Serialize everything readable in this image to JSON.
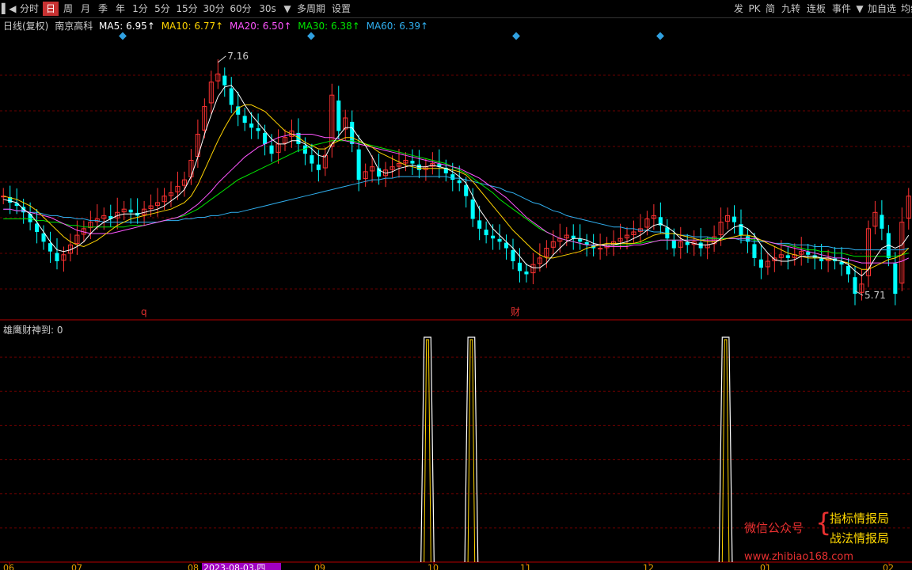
{
  "toolbar": {
    "left_buttons": [
      {
        "label": "▌◀",
        "name": "back-button"
      },
      {
        "label": "分时",
        "name": "tab-intraday"
      },
      {
        "label": "日",
        "name": "tab-day",
        "active": true
      },
      {
        "label": "周",
        "name": "tab-week"
      },
      {
        "label": "月",
        "name": "tab-month"
      },
      {
        "label": "季",
        "name": "tab-quarter"
      },
      {
        "label": "年",
        "name": "tab-year"
      },
      {
        "label": "1分",
        "name": "tab-1min"
      },
      {
        "label": "5分",
        "name": "tab-5min"
      },
      {
        "label": "15分",
        "name": "tab-15min"
      },
      {
        "label": "30分",
        "name": "tab-30min"
      },
      {
        "label": "60分",
        "name": "tab-60min"
      },
      {
        "label": "30s",
        "name": "tab-30s"
      },
      {
        "label": "▼",
        "name": "period-dropdown"
      },
      {
        "label": "多周期",
        "name": "multi-period-button"
      },
      {
        "label": "设置",
        "name": "settings-button"
      }
    ],
    "right_buttons": [
      {
        "label": "发",
        "name": "fa-button"
      },
      {
        "label": "PK",
        "name": "pk-button"
      },
      {
        "label": "简",
        "name": "simple-button"
      },
      {
        "label": "九转",
        "name": "nine-turn-button"
      },
      {
        "label": "连板",
        "name": "consecutive-limit-button"
      },
      {
        "label": "事件",
        "name": "events-button"
      },
      {
        "label": "▼",
        "name": "events-dropdown"
      },
      {
        "label": "加自选",
        "name": "add-watchlist-button"
      },
      {
        "label": "均线",
        "name": "ma-button"
      }
    ]
  },
  "legend": {
    "prefix": "日线(复权)",
    "stock": "南京高科",
    "items": [
      {
        "label": "MA5: 6.95↑",
        "color": "#ffffff"
      },
      {
        "label": "MA10: 6.77↑",
        "color": "#ffd400"
      },
      {
        "label": "MA20: 6.50↑",
        "color": "#ff55ff"
      },
      {
        "label": "MA30: 6.38↑",
        "color": "#00e600"
      },
      {
        "label": "MA60: 6.39↑",
        "color": "#30b0f0"
      }
    ]
  },
  "indicator": {
    "label": "雄鹰财神到: 0"
  },
  "markers": {
    "high": "7.16",
    "low": "5.71",
    "q": "q",
    "cai": "财"
  },
  "x_axis_labels": [
    "06",
    "07",
    "08",
    "2023-08-03,四",
    "09",
    "10",
    "11",
    "12",
    "01",
    "02"
  ],
  "watermark": {
    "line1": "微信公众号",
    "brace": "{",
    "line2": "指标情报局",
    "line3": "战法情报局",
    "line4": "www.zhibiao168.com"
  },
  "colors": {
    "up": "#ff3232",
    "down": "#00ffff",
    "grid": "#6a0000",
    "axis": "#b40000"
  },
  "chart_data": {
    "type": "candlestick",
    "ylim": [
      5.55,
      7.3
    ],
    "close": [
      6.3,
      6.26,
      6.24,
      6.2,
      6.14,
      6.08,
      6.02,
      5.96,
      5.9,
      5.94,
      6.0,
      6.06,
      6.1,
      6.14,
      6.16,
      6.18,
      6.16,
      6.2,
      6.22,
      6.2,
      6.18,
      6.22,
      6.24,
      6.26,
      6.3,
      6.32,
      6.36,
      6.4,
      6.52,
      6.68,
      6.85,
      7.0,
      7.05,
      6.98,
      6.86,
      6.8,
      6.75,
      6.72,
      6.7,
      6.62,
      6.56,
      6.62,
      6.66,
      6.7,
      6.62,
      6.56,
      6.5,
      6.46,
      6.55,
      6.92,
      6.7,
      6.78,
      6.62,
      6.4,
      6.45,
      6.48,
      6.42,
      6.46,
      6.48,
      6.5,
      6.52,
      6.5,
      6.46,
      6.48,
      6.5,
      6.48,
      6.44,
      6.4,
      6.38,
      6.3,
      6.16,
      6.1,
      6.06,
      6.04,
      6.02,
      5.98,
      5.9,
      5.84,
      5.82,
      5.88,
      5.92,
      5.98,
      6.02,
      6.04,
      6.06,
      6.04,
      6.02,
      6.0,
      5.98,
      5.98,
      6.0,
      6.02,
      6.04,
      6.06,
      6.08,
      6.1,
      6.16,
      6.18,
      6.12,
      6.04,
      5.98,
      6.02,
      6.0,
      6.02,
      5.98,
      6.0,
      6.05,
      6.14,
      6.18,
      6.14,
      6.06,
      6.02,
      5.92,
      5.86,
      5.9,
      5.92,
      5.94,
      5.92,
      5.94,
      5.96,
      5.94,
      5.92,
      5.9,
      5.92,
      5.9,
      5.88,
      5.82,
      5.7,
      5.76,
      6.1,
      6.2,
      6.1,
      5.92,
      5.7,
      6.14,
      6.3
    ],
    "ma5": [
      6.28,
      6.27,
      6.26,
      6.22,
      6.19,
      6.14,
      6.08,
      6.02,
      5.97,
      5.96,
      5.97,
      5.99,
      6.02,
      6.07,
      6.11,
      6.14,
      6.16,
      6.18,
      6.19,
      6.19,
      6.19,
      6.2,
      6.21,
      6.22,
      6.24,
      6.27,
      6.3,
      6.34,
      6.42,
      6.54,
      6.68,
      6.8,
      6.91,
      6.97,
      6.98,
      6.93,
      6.86,
      6.8,
      6.75,
      6.7,
      6.65,
      6.62,
      6.62,
      6.64,
      6.64,
      6.62,
      6.59,
      6.55,
      6.54,
      6.62,
      6.67,
      6.72,
      6.72,
      6.66,
      6.61,
      6.54,
      6.46,
      6.44,
      6.45,
      6.47,
      6.48,
      6.49,
      6.48,
      6.48,
      6.49,
      6.48,
      6.47,
      6.45,
      6.42,
      6.38,
      6.3,
      6.22,
      6.16,
      6.1,
      6.06,
      6.02,
      5.98,
      5.93,
      5.88,
      5.86,
      5.86,
      5.89,
      5.94,
      5.98,
      6.02,
      6.04,
      6.04,
      6.03,
      6.01,
      6.0,
      6.0,
      6.0,
      6.01,
      6.02,
      6.04,
      6.06,
      6.09,
      6.12,
      6.13,
      6.11,
      6.08,
      6.04,
      6.02,
      6.01,
      6.0,
      6.0,
      6.01,
      6.04,
      6.08,
      6.11,
      6.12,
      6.1,
      6.06,
      6.0,
      5.95,
      5.91,
      5.9,
      5.9,
      5.91,
      5.93,
      5.93,
      5.93,
      5.92,
      5.92,
      5.91,
      5.9,
      5.88,
      5.84,
      5.81,
      5.85,
      5.92,
      5.98,
      6.0,
      5.98,
      6.0,
      6.06
    ],
    "ma10": [
      6.3,
      6.29,
      6.28,
      6.26,
      6.24,
      6.21,
      6.17,
      6.13,
      6.09,
      6.05,
      6.02,
      6.0,
      5.99,
      6.01,
      6.03,
      6.06,
      6.09,
      6.12,
      6.14,
      6.16,
      6.17,
      6.18,
      6.19,
      6.2,
      6.21,
      6.22,
      6.24,
      6.26,
      6.3,
      6.37,
      6.46,
      6.55,
      6.64,
      6.72,
      6.79,
      6.84,
      6.86,
      6.86,
      6.84,
      6.82,
      6.78,
      6.74,
      6.7,
      6.68,
      6.66,
      6.63,
      6.61,
      6.59,
      6.59,
      6.62,
      6.64,
      6.66,
      6.66,
      6.64,
      6.62,
      6.6,
      6.57,
      6.55,
      6.53,
      6.51,
      6.49,
      6.48,
      6.47,
      6.47,
      6.47,
      6.47,
      6.47,
      6.46,
      6.45,
      6.43,
      6.39,
      6.34,
      6.29,
      6.24,
      6.19,
      6.14,
      6.09,
      6.05,
      6.01,
      5.97,
      5.94,
      5.92,
      5.92,
      5.93,
      5.94,
      5.95,
      5.96,
      5.98,
      5.99,
      6.0,
      6.01,
      6.01,
      6.01,
      6.01,
      6.01,
      6.02,
      6.04,
      6.06,
      6.07,
      6.07,
      6.07,
      6.06,
      6.05,
      6.04,
      6.03,
      6.02,
      6.02,
      6.03,
      6.04,
      6.05,
      6.06,
      6.06,
      6.05,
      6.03,
      6.01,
      5.99,
      5.97,
      5.95,
      5.94,
      5.93,
      5.92,
      5.92,
      5.92,
      5.91,
      5.91,
      5.9,
      5.89,
      5.87,
      5.85,
      5.85,
      5.87,
      5.89,
      5.91,
      5.92,
      5.94,
      5.98
    ],
    "ma20": [
      6.22,
      6.22,
      6.21,
      6.21,
      6.2,
      6.19,
      6.18,
      6.17,
      6.15,
      6.13,
      6.11,
      6.09,
      6.08,
      6.07,
      6.07,
      6.07,
      6.07,
      6.08,
      6.09,
      6.1,
      6.11,
      6.12,
      6.13,
      6.14,
      6.15,
      6.16,
      6.17,
      6.19,
      6.22,
      6.25,
      6.29,
      6.33,
      6.38,
      6.42,
      6.46,
      6.5,
      6.54,
      6.57,
      6.6,
      6.62,
      6.64,
      6.66,
      6.67,
      6.68,
      6.68,
      6.68,
      6.68,
      6.67,
      6.66,
      6.66,
      6.65,
      6.64,
      6.63,
      6.62,
      6.61,
      6.6,
      6.59,
      6.58,
      6.57,
      6.56,
      6.55,
      6.54,
      6.53,
      6.52,
      6.51,
      6.5,
      6.49,
      6.48,
      6.47,
      6.45,
      6.43,
      6.41,
      6.38,
      6.35,
      6.32,
      6.29,
      6.25,
      6.21,
      6.17,
      6.14,
      6.11,
      6.08,
      6.06,
      6.04,
      6.03,
      6.02,
      6.01,
      6.0,
      6.0,
      6.0,
      5.99,
      5.99,
      5.99,
      5.99,
      6.0,
      6.0,
      6.01,
      6.02,
      6.03,
      6.03,
      6.03,
      6.03,
      6.03,
      6.03,
      6.03,
      6.03,
      6.03,
      6.03,
      6.04,
      6.04,
      6.04,
      6.04,
      6.04,
      6.03,
      6.02,
      6.01,
      6.0,
      5.99,
      5.98,
      5.97,
      5.96,
      5.95,
      5.94,
      5.93,
      5.92,
      5.92,
      5.91,
      5.9,
      5.89,
      5.89,
      5.89,
      5.89,
      5.89,
      5.89,
      5.9,
      5.92
    ],
    "ma30": [
      6.16,
      6.16,
      6.16,
      6.16,
      6.16,
      6.15,
      6.15,
      6.14,
      6.14,
      6.13,
      6.12,
      6.12,
      6.11,
      6.11,
      6.11,
      6.11,
      6.11,
      6.11,
      6.11,
      6.12,
      6.12,
      6.12,
      6.13,
      6.14,
      6.15,
      6.16,
      6.17,
      6.18,
      6.2,
      6.22,
      6.25,
      6.28,
      6.31,
      6.34,
      6.37,
      6.4,
      6.42,
      6.44,
      6.46,
      6.48,
      6.5,
      6.52,
      6.54,
      6.56,
      6.58,
      6.59,
      6.61,
      6.62,
      6.63,
      6.64,
      6.64,
      6.64,
      6.64,
      6.63,
      6.62,
      6.61,
      6.6,
      6.59,
      6.58,
      6.57,
      6.56,
      6.55,
      6.54,
      6.53,
      6.52,
      6.51,
      6.5,
      6.48,
      6.46,
      6.44,
      6.41,
      6.38,
      6.35,
      6.32,
      6.28,
      6.25,
      6.22,
      6.19,
      6.16,
      6.13,
      6.1,
      6.08,
      6.06,
      6.04,
      6.03,
      6.02,
      6.01,
      6.0,
      6.0,
      6.0,
      6.0,
      6.0,
      6.0,
      6.0,
      6.01,
      6.01,
      6.02,
      6.02,
      6.03,
      6.03,
      6.03,
      6.03,
      6.03,
      6.03,
      6.03,
      6.04,
      6.04,
      6.04,
      6.04,
      6.04,
      6.04,
      6.04,
      6.03,
      6.03,
      6.02,
      6.01,
      6.0,
      6.0,
      5.99,
      5.98,
      5.97,
      5.97,
      5.96,
      5.96,
      5.95,
      5.95,
      5.94,
      5.93,
      5.93,
      5.93,
      5.93,
      5.93,
      5.93,
      5.93,
      5.94,
      5.95
    ],
    "ma60": [
      6.22,
      6.22,
      6.21,
      6.21,
      6.2,
      6.2,
      6.19,
      6.18,
      6.18,
      6.17,
      6.17,
      6.16,
      6.16,
      6.15,
      6.15,
      6.14,
      6.14,
      6.14,
      6.14,
      6.14,
      6.14,
      6.14,
      6.14,
      6.14,
      6.15,
      6.15,
      6.15,
      6.16,
      6.16,
      6.17,
      6.17,
      6.18,
      6.18,
      6.19,
      6.2,
      6.2,
      6.21,
      6.22,
      6.23,
      6.24,
      6.25,
      6.26,
      6.27,
      6.28,
      6.29,
      6.3,
      6.31,
      6.32,
      6.33,
      6.34,
      6.35,
      6.36,
      6.37,
      6.38,
      6.39,
      6.4,
      6.4,
      6.41,
      6.41,
      6.42,
      6.42,
      6.42,
      6.42,
      6.42,
      6.42,
      6.42,
      6.42,
      6.41,
      6.41,
      6.4,
      6.39,
      6.38,
      6.37,
      6.36,
      6.35,
      6.33,
      6.32,
      6.3,
      6.28,
      6.26,
      6.25,
      6.23,
      6.21,
      6.2,
      6.18,
      6.17,
      6.16,
      6.15,
      6.14,
      6.13,
      6.12,
      6.11,
      6.11,
      6.1,
      6.1,
      6.09,
      6.09,
      6.08,
      6.08,
      6.07,
      6.07,
      6.06,
      6.06,
      6.05,
      6.05,
      6.05,
      6.04,
      6.04,
      6.04,
      6.04,
      6.03,
      6.03,
      6.02,
      6.02,
      6.02,
      6.01,
      6.01,
      6.01,
      6.0,
      6.0,
      6.0,
      5.99,
      5.99,
      5.99,
      5.98,
      5.98,
      5.98,
      5.97,
      5.97,
      5.97,
      5.97,
      5.97,
      5.97,
      5.97,
      5.97,
      5.98
    ],
    "signal": {
      "pulses": [
        {
          "start": 96,
          "end": 99
        },
        {
          "start": 106,
          "end": 109
        },
        {
          "start": 164,
          "end": 167
        }
      ],
      "max": 1,
      "value": 0
    },
    "x_tick_positions": [
      12,
      98,
      245,
      405,
      548,
      665,
      820,
      968,
      1123
    ]
  }
}
